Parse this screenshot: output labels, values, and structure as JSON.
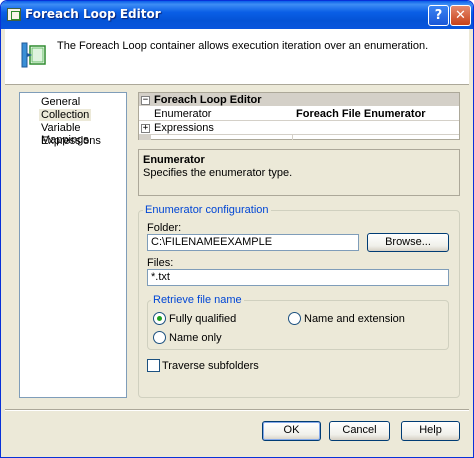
{
  "window": {
    "title": "Foreach Loop Editor"
  },
  "header": {
    "description": "The Foreach Loop container allows execution iteration over an enumeration."
  },
  "sidebar": {
    "items": [
      {
        "label": "General"
      },
      {
        "label": "Collection"
      },
      {
        "label": "Variable Mappings"
      },
      {
        "label": "Expressions"
      }
    ],
    "selected": "Collection"
  },
  "property_grid": {
    "category": "Foreach Loop Editor",
    "rows": [
      {
        "name": "Enumerator",
        "value": "Foreach File Enumerator"
      },
      {
        "name": "Expressions",
        "value": ""
      }
    ]
  },
  "description_panel": {
    "title": "Enumerator",
    "text": "Specifies the enumerator type."
  },
  "enumerator_config": {
    "legend": "Enumerator configuration",
    "folder_label": "Folder:",
    "folder_value": "C:\\FILENAMEEXAMPLE",
    "browse_label": "Browse...",
    "files_label": "Files:",
    "files_value": "*.txt"
  },
  "retrieve": {
    "legend": "Retrieve file name",
    "options": [
      {
        "label": "Fully qualified",
        "selected": true
      },
      {
        "label": "Name and extension",
        "selected": false
      },
      {
        "label": "Name only",
        "selected": false
      }
    ]
  },
  "traverse": {
    "label": "Traverse subfolders",
    "checked": false
  },
  "footer": {
    "ok_label": "OK",
    "cancel_label": "Cancel",
    "help_label": "Help"
  },
  "colors": {
    "titlebar": "#0a5fe6",
    "dialog_bg": "#ece9d8",
    "group_legend": "#0046d5",
    "radio_dot": "#21a121"
  },
  "icons": [
    "app-icon",
    "help-icon",
    "close-icon",
    "foreach-loop-icon",
    "expand-plus-icon",
    "collapse-minus-icon"
  ]
}
